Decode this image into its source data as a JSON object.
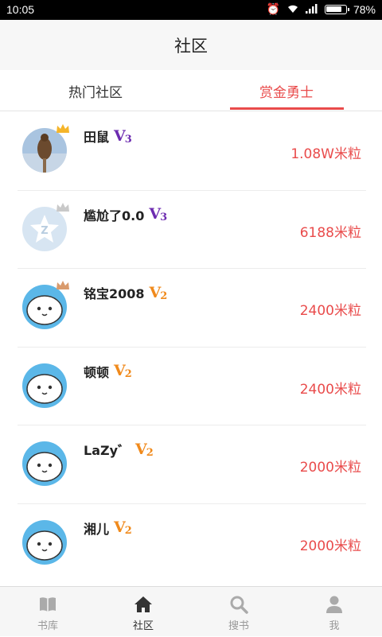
{
  "status": {
    "time": "10:05",
    "battery": "78%"
  },
  "header": {
    "title": "社区"
  },
  "tabs": [
    {
      "label": "热门社区",
      "active": false
    },
    {
      "label": "赏金勇士",
      "active": true
    }
  ],
  "rows": [
    {
      "name": "田鼠",
      "level": "V",
      "level_num": "3",
      "reward": "1.08W米粒",
      "crown": "gold"
    },
    {
      "name": "尴尬了0.0",
      "level": "V",
      "level_num": "3",
      "reward": "6188米粒",
      "crown": "silver"
    },
    {
      "name": "铭宝2008",
      "level": "V",
      "level_num": "2",
      "reward": "2400米粒",
      "crown": "bronze"
    },
    {
      "name": "顿顿",
      "level": "V",
      "level_num": "2",
      "reward": "2400米粒",
      "crown": ""
    },
    {
      "name": "LaZy゛",
      "level": "V",
      "level_num": "2",
      "reward": "2000米粒",
      "crown": ""
    },
    {
      "name": "湘儿",
      "level": "V",
      "level_num": "2",
      "reward": "2000米粒",
      "crown": ""
    }
  ],
  "nav": [
    {
      "label": "书库",
      "icon": "book-icon",
      "active": false
    },
    {
      "label": "社区",
      "icon": "home-icon",
      "active": true
    },
    {
      "label": "搜书",
      "icon": "search-icon",
      "active": false
    },
    {
      "label": "我",
      "icon": "person-icon",
      "active": false
    }
  ],
  "colors": {
    "accent": "#e94b4b",
    "v3": "#6c2bb0",
    "v2": "#f08a1c"
  }
}
